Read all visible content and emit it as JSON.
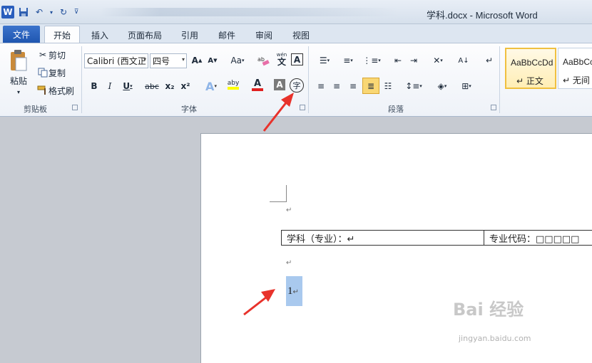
{
  "window": {
    "title": "学科.docx - Microsoft Word",
    "logo_letter": "W"
  },
  "quick_access": {
    "save_icon": "save-icon",
    "undo_icon": "undo-icon",
    "redo_icon": "redo-icon"
  },
  "tabs": {
    "file": "文件",
    "items": [
      "开始",
      "插入",
      "页面布局",
      "引用",
      "邮件",
      "审阅",
      "视图"
    ],
    "active": "开始"
  },
  "clipboard": {
    "paste": "粘贴",
    "cut": "剪切",
    "copy": "复制",
    "format_painter": "格式刷",
    "group_label": "剪贴板"
  },
  "font": {
    "font_name": "Calibri (西文正",
    "font_size": "四号",
    "change_case": "Aa",
    "bold": "B",
    "italic": "I",
    "underline": "U",
    "strikethrough": "abc",
    "subscript": "x₂",
    "superscript": "x²",
    "text_effect": "A",
    "highlight": "aby",
    "font_color": "A",
    "shading": "A",
    "enclose": "字",
    "pinyin": "wén",
    "border": "A",
    "group_label": "字体"
  },
  "paragraph": {
    "group_label": "段落"
  },
  "styles": {
    "sample1": "AaBbCcDd",
    "name1": "↵ 正文",
    "sample2": "AaBbCc",
    "name2": "↵ 无间"
  },
  "document": {
    "table_cell_1": "学科（专业）：↵",
    "table_cell_2": "专业代码：□□□□□",
    "selected_text": "1",
    "para_mark": "↵"
  },
  "watermark": {
    "main": "Bai 经验",
    "sub": "jingyan.baidu.com"
  },
  "colors": {
    "file_tab": "#2a5ebd",
    "highlight": "#a9c9ee",
    "arrow": "#e8322b"
  }
}
